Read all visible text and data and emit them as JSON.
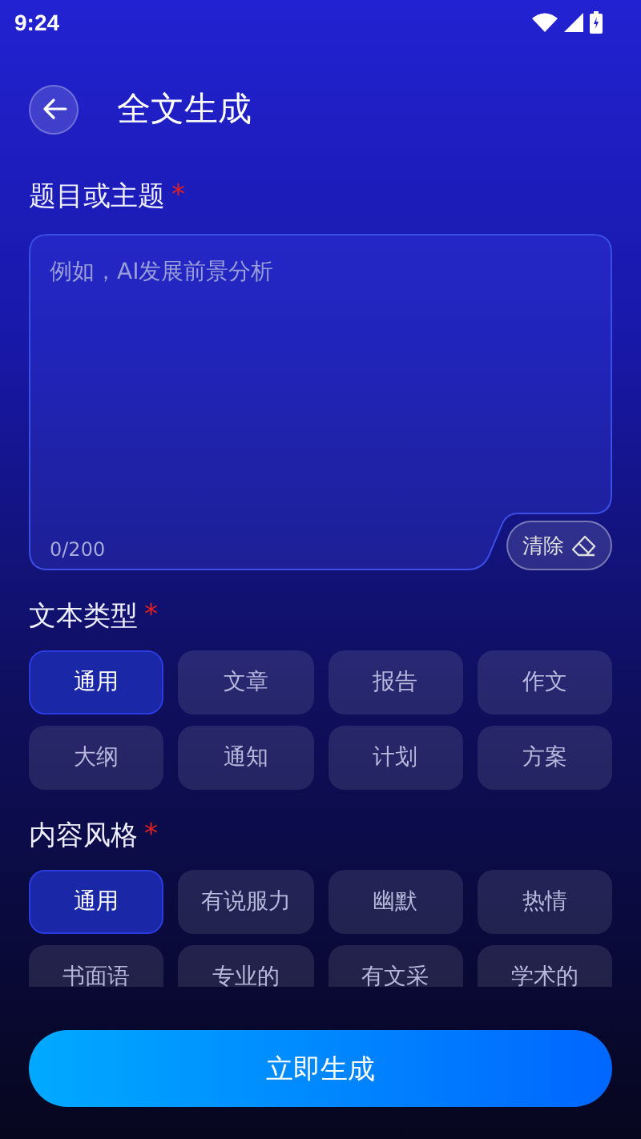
{
  "status_bar": {
    "time": "9:24"
  },
  "header": {
    "title": "全文生成"
  },
  "topic": {
    "label": "题目或主题",
    "required": "*",
    "placeholder": "例如，AI发展前景分析",
    "counter": "0/200",
    "clear_button": "清除"
  },
  "text_type": {
    "label": "文本类型",
    "required": "*",
    "options": [
      {
        "label": "通用",
        "selected": true
      },
      {
        "label": "文章",
        "selected": false
      },
      {
        "label": "报告",
        "selected": false
      },
      {
        "label": "作文",
        "selected": false
      },
      {
        "label": "大纲",
        "selected": false
      },
      {
        "label": "通知",
        "selected": false
      },
      {
        "label": "计划",
        "selected": false
      },
      {
        "label": "方案",
        "selected": false
      }
    ]
  },
  "content_style": {
    "label": "内容风格",
    "required": "*",
    "options": [
      {
        "label": "通用",
        "selected": true
      },
      {
        "label": "有说服力",
        "selected": false
      },
      {
        "label": "幽默",
        "selected": false
      },
      {
        "label": "热情",
        "selected": false
      },
      {
        "label": "书面语",
        "selected": false
      },
      {
        "label": "专业的",
        "selected": false
      },
      {
        "label": "有文采",
        "selected": false
      },
      {
        "label": "学术的",
        "selected": false
      }
    ]
  },
  "generate_button": "立即生成"
}
